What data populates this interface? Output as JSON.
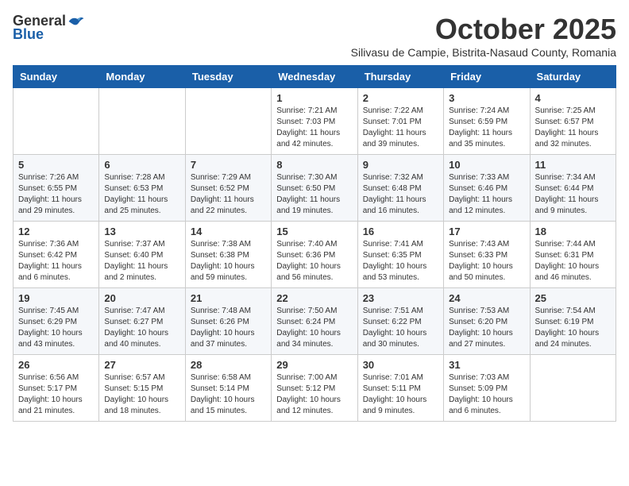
{
  "header": {
    "logo_general": "General",
    "logo_blue": "Blue",
    "month_title": "October 2025",
    "location": "Silivasu de Campie, Bistrita-Nasaud County, Romania"
  },
  "weekdays": [
    "Sunday",
    "Monday",
    "Tuesday",
    "Wednesday",
    "Thursday",
    "Friday",
    "Saturday"
  ],
  "weeks": [
    [
      {
        "day": "",
        "info": ""
      },
      {
        "day": "",
        "info": ""
      },
      {
        "day": "",
        "info": ""
      },
      {
        "day": "1",
        "info": "Sunrise: 7:21 AM\nSunset: 7:03 PM\nDaylight: 11 hours\nand 42 minutes."
      },
      {
        "day": "2",
        "info": "Sunrise: 7:22 AM\nSunset: 7:01 PM\nDaylight: 11 hours\nand 39 minutes."
      },
      {
        "day": "3",
        "info": "Sunrise: 7:24 AM\nSunset: 6:59 PM\nDaylight: 11 hours\nand 35 minutes."
      },
      {
        "day": "4",
        "info": "Sunrise: 7:25 AM\nSunset: 6:57 PM\nDaylight: 11 hours\nand 32 minutes."
      }
    ],
    [
      {
        "day": "5",
        "info": "Sunrise: 7:26 AM\nSunset: 6:55 PM\nDaylight: 11 hours\nand 29 minutes."
      },
      {
        "day": "6",
        "info": "Sunrise: 7:28 AM\nSunset: 6:53 PM\nDaylight: 11 hours\nand 25 minutes."
      },
      {
        "day": "7",
        "info": "Sunrise: 7:29 AM\nSunset: 6:52 PM\nDaylight: 11 hours\nand 22 minutes."
      },
      {
        "day": "8",
        "info": "Sunrise: 7:30 AM\nSunset: 6:50 PM\nDaylight: 11 hours\nand 19 minutes."
      },
      {
        "day": "9",
        "info": "Sunrise: 7:32 AM\nSunset: 6:48 PM\nDaylight: 11 hours\nand 16 minutes."
      },
      {
        "day": "10",
        "info": "Sunrise: 7:33 AM\nSunset: 6:46 PM\nDaylight: 11 hours\nand 12 minutes."
      },
      {
        "day": "11",
        "info": "Sunrise: 7:34 AM\nSunset: 6:44 PM\nDaylight: 11 hours\nand 9 minutes."
      }
    ],
    [
      {
        "day": "12",
        "info": "Sunrise: 7:36 AM\nSunset: 6:42 PM\nDaylight: 11 hours\nand 6 minutes."
      },
      {
        "day": "13",
        "info": "Sunrise: 7:37 AM\nSunset: 6:40 PM\nDaylight: 11 hours\nand 2 minutes."
      },
      {
        "day": "14",
        "info": "Sunrise: 7:38 AM\nSunset: 6:38 PM\nDaylight: 10 hours\nand 59 minutes."
      },
      {
        "day": "15",
        "info": "Sunrise: 7:40 AM\nSunset: 6:36 PM\nDaylight: 10 hours\nand 56 minutes."
      },
      {
        "day": "16",
        "info": "Sunrise: 7:41 AM\nSunset: 6:35 PM\nDaylight: 10 hours\nand 53 minutes."
      },
      {
        "day": "17",
        "info": "Sunrise: 7:43 AM\nSunset: 6:33 PM\nDaylight: 10 hours\nand 50 minutes."
      },
      {
        "day": "18",
        "info": "Sunrise: 7:44 AM\nSunset: 6:31 PM\nDaylight: 10 hours\nand 46 minutes."
      }
    ],
    [
      {
        "day": "19",
        "info": "Sunrise: 7:45 AM\nSunset: 6:29 PM\nDaylight: 10 hours\nand 43 minutes."
      },
      {
        "day": "20",
        "info": "Sunrise: 7:47 AM\nSunset: 6:27 PM\nDaylight: 10 hours\nand 40 minutes."
      },
      {
        "day": "21",
        "info": "Sunrise: 7:48 AM\nSunset: 6:26 PM\nDaylight: 10 hours\nand 37 minutes."
      },
      {
        "day": "22",
        "info": "Sunrise: 7:50 AM\nSunset: 6:24 PM\nDaylight: 10 hours\nand 34 minutes."
      },
      {
        "day": "23",
        "info": "Sunrise: 7:51 AM\nSunset: 6:22 PM\nDaylight: 10 hours\nand 30 minutes."
      },
      {
        "day": "24",
        "info": "Sunrise: 7:53 AM\nSunset: 6:20 PM\nDaylight: 10 hours\nand 27 minutes."
      },
      {
        "day": "25",
        "info": "Sunrise: 7:54 AM\nSunset: 6:19 PM\nDaylight: 10 hours\nand 24 minutes."
      }
    ],
    [
      {
        "day": "26",
        "info": "Sunrise: 6:56 AM\nSunset: 5:17 PM\nDaylight: 10 hours\nand 21 minutes."
      },
      {
        "day": "27",
        "info": "Sunrise: 6:57 AM\nSunset: 5:15 PM\nDaylight: 10 hours\nand 18 minutes."
      },
      {
        "day": "28",
        "info": "Sunrise: 6:58 AM\nSunset: 5:14 PM\nDaylight: 10 hours\nand 15 minutes."
      },
      {
        "day": "29",
        "info": "Sunrise: 7:00 AM\nSunset: 5:12 PM\nDaylight: 10 hours\nand 12 minutes."
      },
      {
        "day": "30",
        "info": "Sunrise: 7:01 AM\nSunset: 5:11 PM\nDaylight: 10 hours\nand 9 minutes."
      },
      {
        "day": "31",
        "info": "Sunrise: 7:03 AM\nSunset: 5:09 PM\nDaylight: 10 hours\nand 6 minutes."
      },
      {
        "day": "",
        "info": ""
      }
    ]
  ]
}
